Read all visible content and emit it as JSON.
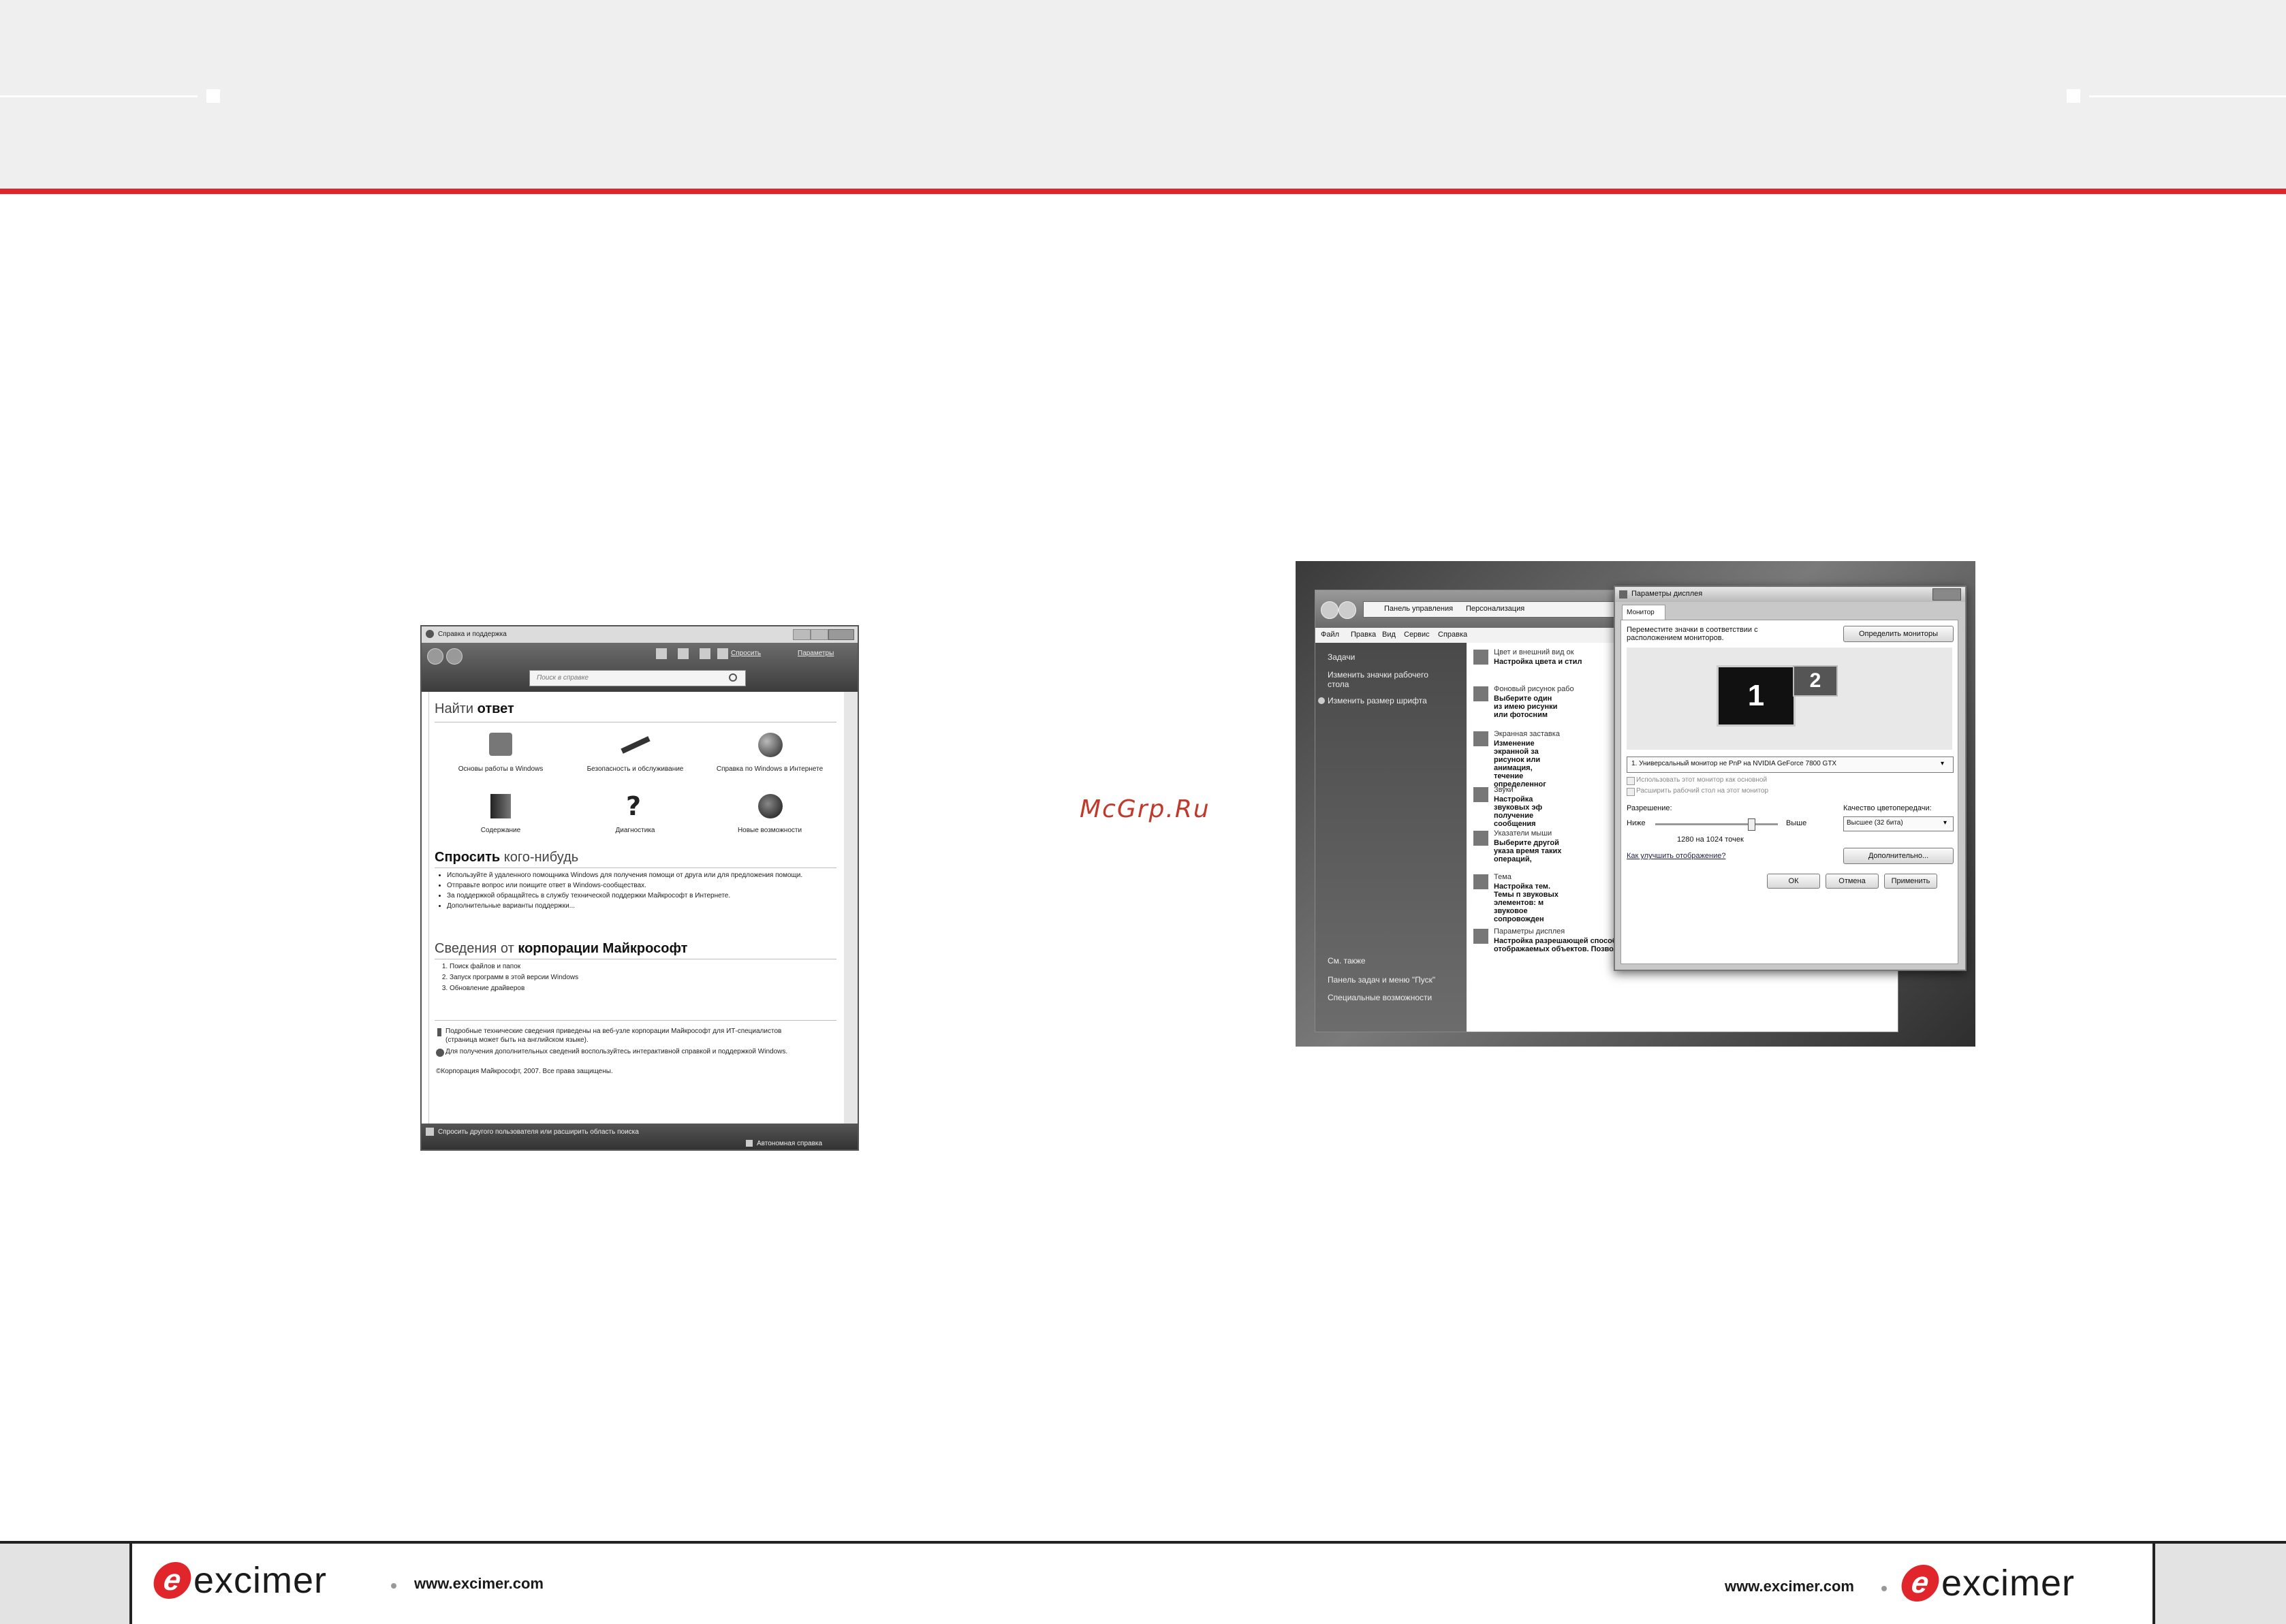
{
  "watermark": "McGrp.Ru",
  "footer": {
    "left_logo": "excimer",
    "left_url": "www.excimer.com",
    "right_url": "www.excimer.com",
    "right_logo": "excimer"
  },
  "shot1": {
    "title": "Справка и поддержка",
    "search_placeholder": "Поиск в справке",
    "ask_link": "Спросить",
    "params_link": "Параметры",
    "find_heading_light": "Найти",
    "find_heading_bold": "ответ",
    "tiles": [
      {
        "label": "Основы работы в Windows",
        "icon": "windows-flag-icon"
      },
      {
        "label": "Безопасность и обслуживание",
        "icon": "wrench-icon"
      },
      {
        "label": "Справка по Windows в Интернете",
        "icon": "globe-icon"
      },
      {
        "label": "Содержание",
        "icon": "book-icon"
      },
      {
        "label": "Диагностика",
        "icon": "question-icon"
      },
      {
        "label": "Новые возможности",
        "icon": "windows-orb-icon"
      }
    ],
    "ask_heading_bold": "Спросить",
    "ask_heading_light": "кого-нибудь",
    "ask_items": [
      "Используйте й удаленного помощника Windows для получения помощи от друга или для предложения помощи.",
      "Отправьте вопрос или поищите ответ в Windows-сообществах.",
      "За поддержкой обращайтесь в службу технической поддержки Майкрософт в Интернете.",
      "Дополнительные варианты поддержки..."
    ],
    "info_heading_light": "Сведения от",
    "info_heading_bold": "корпорации Майкрософт",
    "info_items": [
      "Поиск файлов и папок",
      "Запуск программ в этой версии Windows",
      "Обновление драйверов"
    ],
    "tech_note": "Подробные технические сведения приведены на веб-узле корпорации Майкрософт для ИТ-специалистов (страница может быть на английском языке).",
    "help_note": "Для получения дополнительных сведений воспользуйтесь интерактивной справкой и поддержкой Windows.",
    "copyright": "©Корпорация Майкрософт, 2007. Все права защищены.",
    "status_left": "Спросить другого пользователя или расширить область поиска",
    "status_right": "Автономная справка"
  },
  "shot2": {
    "breadcrumb": [
      "Панель управления",
      "Персонализация"
    ],
    "menu": [
      "Файл",
      "Правка",
      "Вид",
      "Сервис",
      "Справка"
    ],
    "side_title": "Задачи",
    "side_items": [
      "Изменить значки рабочего стола",
      "Изменить размер шрифта"
    ],
    "side_bottom_title": "См. также",
    "side_bottom": [
      "Панель задач и меню \"Пуск\"",
      "Специальные возможности"
    ],
    "main_items": [
      {
        "title": "Цвет и внешний вид ок",
        "desc": "Настройка цвета и стил"
      },
      {
        "title": "Фоновый рисунок рабо",
        "desc": "Выберите один из имею рисунки или фотосним"
      },
      {
        "title": "Экранная заставка",
        "desc": "Изменение экранной за рисунок или анимация, течение определенног"
      },
      {
        "title": "Звуки",
        "desc": "Настройка звуковых эф получение сообщения"
      },
      {
        "title": "Указатели мыши",
        "desc": "Выберите другой указа время таких операций,"
      },
      {
        "title": "Тема",
        "desc": "Настройка тем. Темы п звуковых элементов: м звуковое сопровожден"
      },
      {
        "title": "Параметры дисплея",
        "desc": "Настройка разрешающей способности экрана, позволяет регулировать масштаб и количество отображаемых объектов. Позволяет также регулировать мерцание монитора (частоту обновления)."
      }
    ],
    "dialog": {
      "title": "Параметры дисплея",
      "tab": "Монитор",
      "instruction": "Переместите значки в соответствии с расположением мониторов.",
      "identify_btn": "Определить мониторы",
      "monitor1": "1",
      "monitor2": "2",
      "monitor_select": "1. Универсальный монитор не PnP на NVIDIA GeForce 7800 GTX",
      "chk_primary": "Использовать этот монитор как основной",
      "chk_extend": "Расширить рабочий стол на этот монитор",
      "resolution_label": "Разрешение:",
      "low": "Ниже",
      "high": "Выше",
      "resolution_value": "1280 на 1024 точек",
      "quality_label": "Качество цветопередачи:",
      "quality_value": "Высшее (32 бита)",
      "advanced_btn": "Дополнительно...",
      "improve_link": "Как улучшить отображение?",
      "ok": "ОК",
      "cancel": "Отмена",
      "apply": "Применить"
    }
  }
}
